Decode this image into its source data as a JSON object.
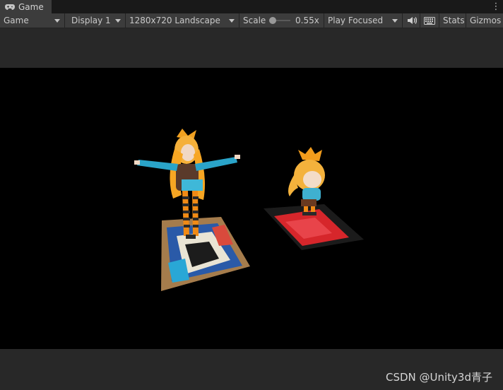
{
  "tab": {
    "label": "Game",
    "icon": "gamepad-icon"
  },
  "toolbar": {
    "mode": "Game",
    "display": "Display 1",
    "resolution": "1280x720 Landscape",
    "scale_label": "Scale",
    "scale_value": "0.55x",
    "play_mode": "Play Focused",
    "mute_icon": "speaker-icon",
    "stats_icon": "keyboard-icon",
    "stats": "Stats",
    "gizmos": "Gizmos"
  },
  "watermark": "CSDN @Unity3d青子",
  "colors": {
    "toolbar_bg": "#3c3c3c",
    "tabbar_bg": "#191919",
    "panel_bg": "#282828",
    "viewport_bg": "#000000"
  }
}
